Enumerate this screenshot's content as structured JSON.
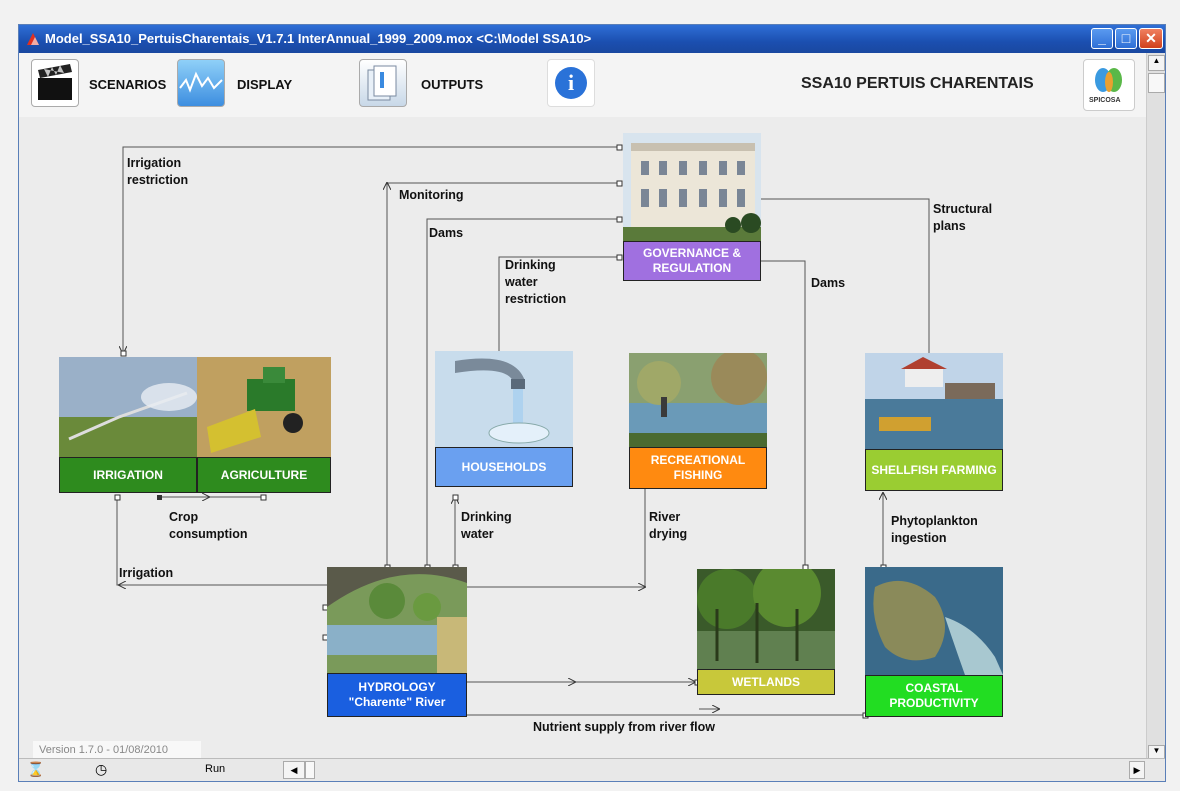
{
  "window": {
    "title": "Model_SSA10_PertuisCharentais_V1.7.1 InterAnnual_1999_2009.mox    <C:\\Model SSA10>",
    "minimize_glyph": "_",
    "maximize_glyph": "□",
    "close_glyph": "✕"
  },
  "toolbar": {
    "scenarios_label": "SCENARIOS",
    "display_label": "DISPLAY",
    "outputs_label": "OUTPUTS",
    "info_glyph": "i",
    "model_title": "SSA10 PERTUIS CHARENTAIS",
    "logo_text": "SPICOSA"
  },
  "nodes": {
    "governance": "GOVERNANCE &\nREGULATION",
    "irrigation": "IRRIGATION",
    "agriculture": "AGRICULTURE",
    "households": "HOUSEHOLDS",
    "recreational": "RECREATIONAL\nFISHING",
    "shellfish": "SHELLFISH\nFARMING",
    "hydrology": "HYDROLOGY\n\"Charente\" River",
    "wetlands": "WETLANDS",
    "coastal": "COASTAL\nPRODUCTIVITY"
  },
  "links": {
    "irrigation_restriction": "Irrigation\nrestriction",
    "monitoring": "Monitoring",
    "dams_left": "Dams",
    "drinking_water_restriction": "Drinking\nwater\nrestriction",
    "dams_right": "Dams",
    "structural_plans": "Structural\nplans",
    "crop_consumption": "Crop\nconsumption",
    "irrigation": "Irrigation",
    "drinking_water": "Drinking\nwater",
    "river_drying": "River\ndrying",
    "phytoplankton_ingestion": "Phytoplankton\ningestion",
    "nutrient_supply": "Nutrient supply from river flow"
  },
  "status": {
    "version": "Version 1.7.0 - 01/08/2010",
    "run_label": "Run",
    "hourglass_glyph": "⌛",
    "clock_glyph": "◷"
  },
  "colors": {
    "governance": "#a070e0",
    "irrigation": "#2e8b1e",
    "agriculture": "#2e8b1e",
    "households": "#6aa0f0",
    "recreational": "#ff8a10",
    "shellfish": "#9acd32",
    "hydrology": "#1a5fe0",
    "wetlands": "#c8c83a",
    "coastal": "#22dd22"
  }
}
